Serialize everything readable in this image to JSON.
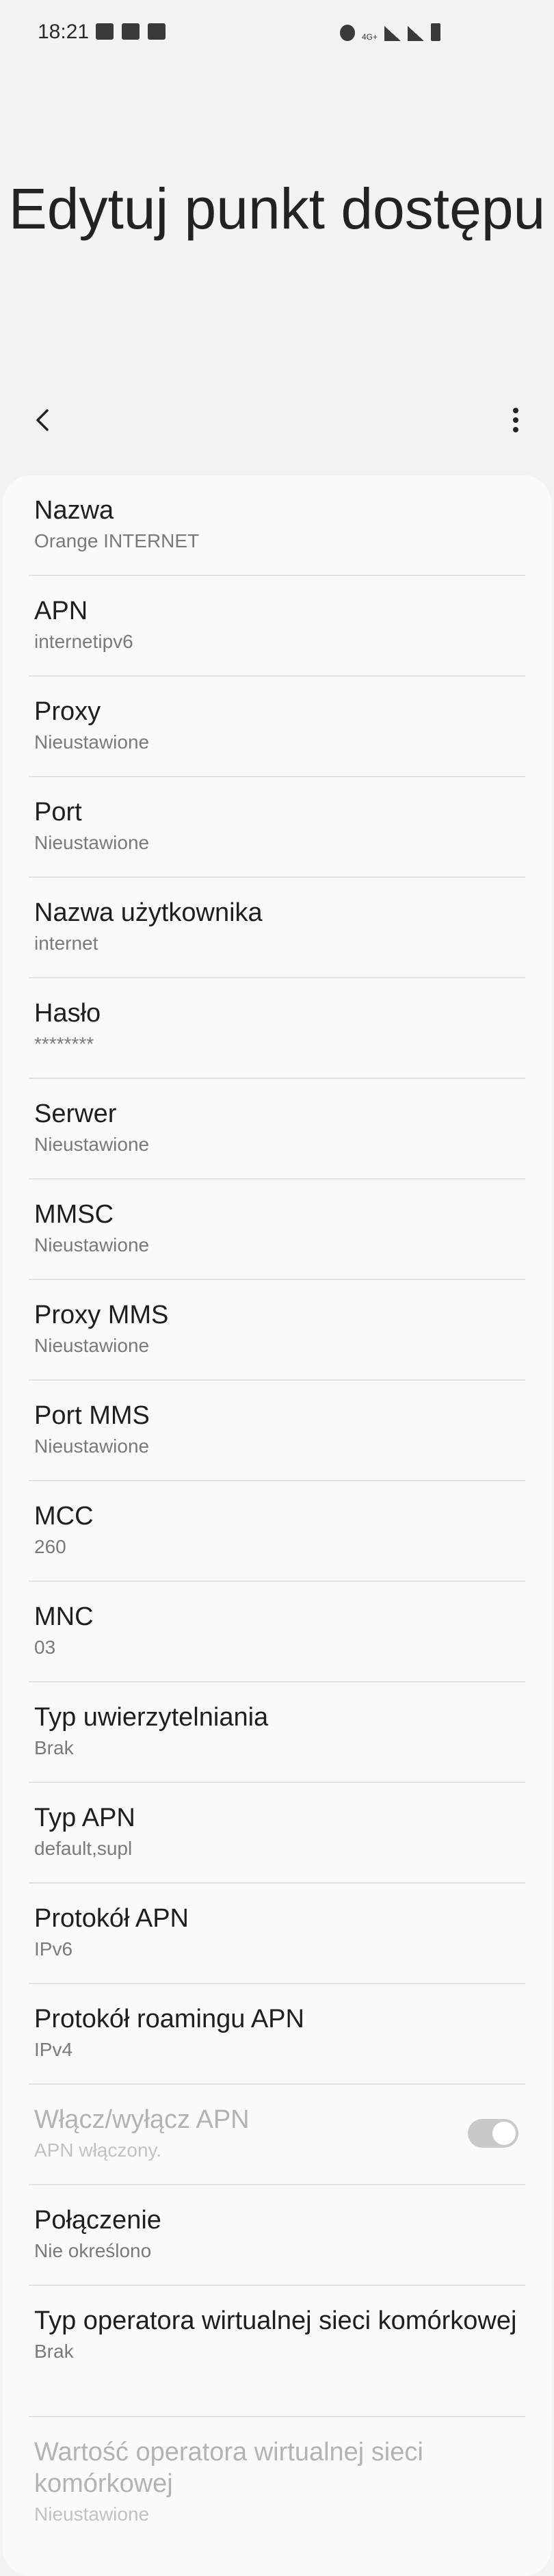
{
  "status_bar": {
    "time": "18:21",
    "network_label": "4G+"
  },
  "header": {
    "title": "Edytuj punkt dostępu"
  },
  "icons": {
    "back": "chevron-left-icon",
    "more": "more-vert-icon"
  },
  "items": [
    {
      "title": "Nazwa",
      "summary": "Orange INTERNET"
    },
    {
      "title": "APN",
      "summary": "internetipv6"
    },
    {
      "title": "Proxy",
      "summary": "Nieustawione"
    },
    {
      "title": "Port",
      "summary": "Nieustawione"
    },
    {
      "title": "Nazwa użytkownika",
      "summary": "internet"
    },
    {
      "title": "Hasło",
      "summary": "********"
    },
    {
      "title": "Serwer",
      "summary": "Nieustawione"
    },
    {
      "title": "MMSC",
      "summary": "Nieustawione"
    },
    {
      "title": "Proxy MMS",
      "summary": "Nieustawione"
    },
    {
      "title": "Port MMS",
      "summary": "Nieustawione"
    },
    {
      "title": "MCC",
      "summary": "260"
    },
    {
      "title": "MNC",
      "summary": "03"
    },
    {
      "title": "Typ uwierzytelniania",
      "summary": "Brak"
    },
    {
      "title": "Typ APN",
      "summary": "default,supl"
    },
    {
      "title": "Protokół APN",
      "summary": "IPv6"
    },
    {
      "title": "Protokół roamingu APN",
      "summary": "IPv4"
    },
    {
      "title": "Włącz/wyłącz APN",
      "summary": "APN włączony."
    },
    {
      "title": "Połączenie",
      "summary": "Nie określono"
    },
    {
      "title": "Typ operatora wirtualnej sieci komórkowej",
      "summary": "Brak"
    },
    {
      "title": "Wartość operatora wirtualnej sieci komórkowej",
      "summary": "Nieustawione"
    }
  ],
  "toggle": {
    "apn_enabled": true
  },
  "colors": {
    "background": "#f3f3f3",
    "card": "#fafafa",
    "text_primary": "#1e1e1e",
    "text_secondary": "#7a7a7a",
    "text_disabled": "#b3b3b3"
  }
}
